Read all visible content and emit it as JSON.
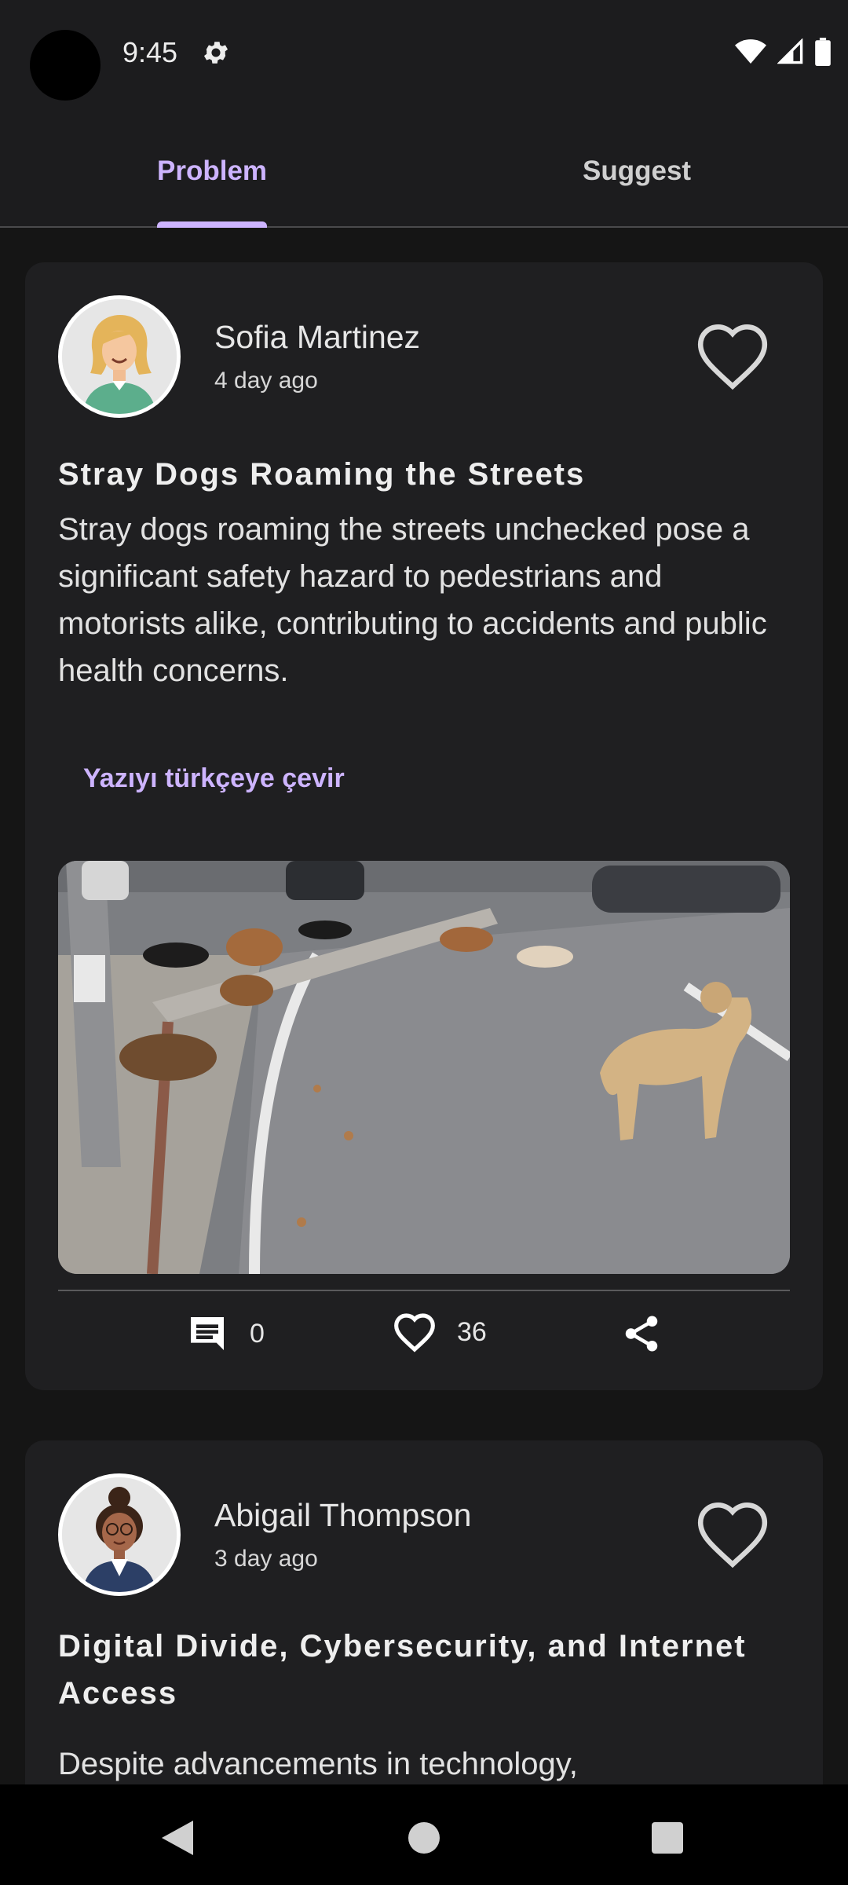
{
  "status_bar": {
    "time": "9:45"
  },
  "tabs": [
    {
      "label": "Problem",
      "selected": true
    },
    {
      "label": "Suggest",
      "selected": false
    }
  ],
  "colors": {
    "accent": "#cdb4ff",
    "background": "#151515",
    "card": "#1f1f21"
  },
  "posts": [
    {
      "author": "Sofia Martinez",
      "time_ago": "4 day ago",
      "title": "Stray Dogs Roaming the Streets",
      "body": "Stray dogs roaming the streets unchecked pose a significant safety hazard to pedestrians and motorists alike, contributing to accidents and public health concerns.",
      "translate_label": "Yazıyı türkçeye çevir",
      "comments": "0",
      "likes": "36"
    },
    {
      "author": "Abigail Thompson",
      "time_ago": "3 day ago",
      "title": "Digital Divide, Cybersecurity, and Internet Access",
      "body": "Despite advancements in technology,"
    }
  ],
  "icons": [
    "gear-icon",
    "wifi-icon",
    "signal-icon",
    "battery-icon",
    "heart-icon",
    "comment-icon",
    "share-icon",
    "back-icon",
    "home-icon",
    "recents-icon"
  ]
}
